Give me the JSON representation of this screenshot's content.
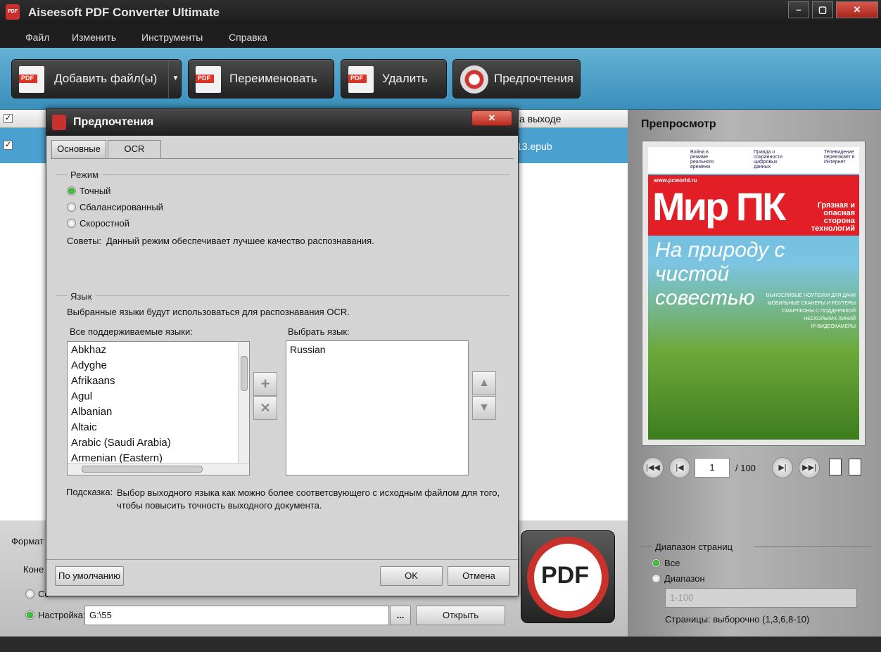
{
  "window": {
    "title": "Aiseesoft PDF Converter Ultimate",
    "controls": [
      "–",
      "▢",
      "✕"
    ]
  },
  "menu": [
    "Файл",
    "Изменить",
    "Инструменты",
    "Справка"
  ],
  "toolbar": {
    "add_label": "Добавить файл(ы)",
    "rename_label": "Переименовать",
    "delete_label": "Удалить",
    "prefs_label": "Предпочтения"
  },
  "file_list": {
    "header_output": "а выходе",
    "row_output": "13.epub"
  },
  "bottom": {
    "format_label": "Формат",
    "dest_label": "Коне",
    "source_label": "Со",
    "custom_label": "Настройка:",
    "path_value": "G:\\55",
    "browse_label": "...",
    "open_label": "Открыть"
  },
  "preview": {
    "title": "Препросмотр",
    "page_current": "1",
    "page_total": "/ 100",
    "cover": {
      "logo": "Мир ПК",
      "url": "www.pcworld.ru",
      "side": "Грязная и опасная сторона технологий",
      "headline": "На природу с чистой совестью",
      "bullets": [
        "ВЫНОСЛИВЫЕ НОУТБУКИ ДЛЯ ДАЧИ",
        "МОБИЛЬНЫЕ СКАНЕРЫ И РОУТЕРЫ",
        "СМАРТФОНЫ С ПОДДЕРЖКОЙ НЕСКОЛЬКИХ ЛИНИЙ",
        "IP-ВИДЕОКАМЕРЫ"
      ],
      "teasers": [
        "Война в режиме реального времени",
        "Правда о сохранности цифровых данных",
        "Телевидение переезжает в Интернет"
      ]
    },
    "range": {
      "title": "Диапазон страниц",
      "all_label": "Все",
      "range_label": "Диапазон",
      "range_placeholder": "1-100",
      "hint": "Страницы: выборочно (1,3,6,8-10)"
    }
  },
  "dialog": {
    "title": "Предпочтения",
    "close": "✕",
    "tabs": [
      "Основные",
      "OCR"
    ],
    "active_tab": "OCR",
    "mode": {
      "title": "Режим",
      "options": [
        "Точный",
        "Сбалансированный",
        "Скоростной"
      ],
      "selected": "Точный",
      "tips_label": "Советы:",
      "tips_text": "Данный режим обеспечивает лучшее качество распознавания."
    },
    "language": {
      "title": "Язык",
      "desc": "Выбранные языки будут использоваться для распознавания OCR.",
      "all_label": "Все поддерживаемые языки:",
      "selected_label": "Выбрать язык:",
      "all_languages": [
        "Abkhaz",
        "Adyghe",
        "Afrikaans",
        "Agul",
        "Albanian",
        "Altaic",
        "Arabic (Saudi Arabia)",
        "Armenian (Eastern)"
      ],
      "selected_languages": [
        "Russian"
      ],
      "hint_label": "Подсказка:",
      "hint_text": "Выбор выходного языка как можно более соответсвующего с исходным файлом для того, чтобы повысить точность выходного документа."
    },
    "default_button": "По умолчанию",
    "ok_button": "OK",
    "cancel_button": "Отмена"
  },
  "big_button": "PDF"
}
